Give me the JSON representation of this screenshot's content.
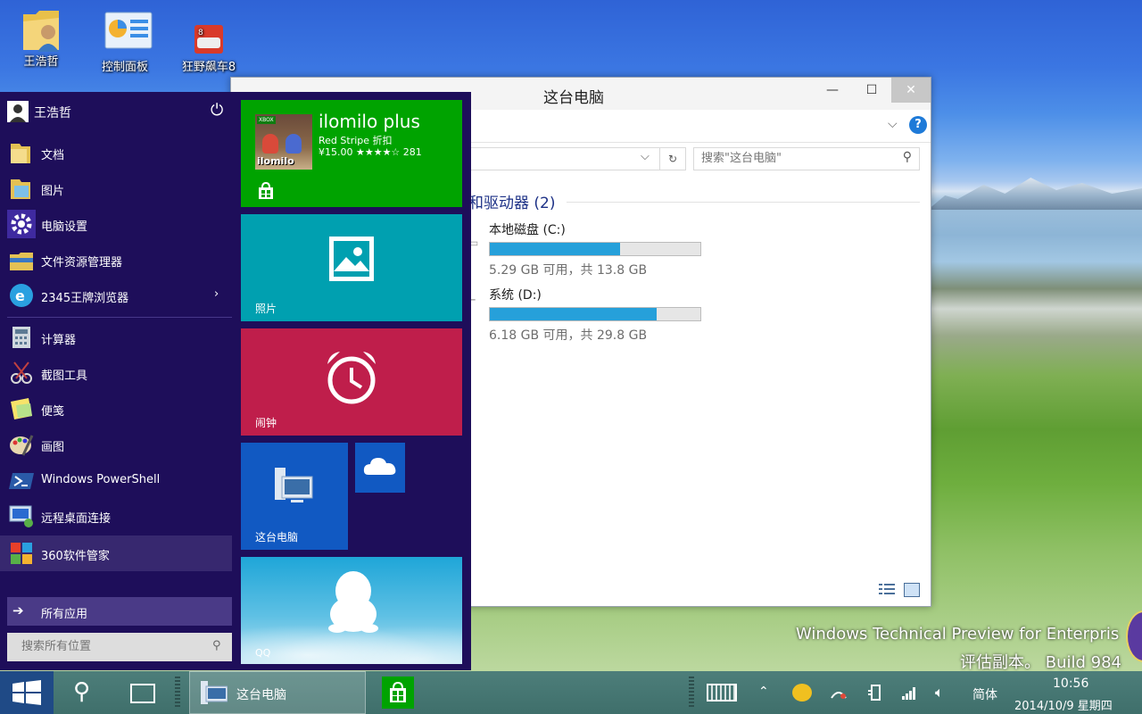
{
  "desktop": {
    "icons": [
      {
        "label": "王浩哲",
        "icon": "user-folder-icon"
      },
      {
        "label": "控制面板",
        "icon": "control-panel-icon"
      },
      {
        "label": "狂野飙车8",
        "icon": "asphalt-8-icon"
      }
    ],
    "watermark": {
      "line1": "Windows Technical Preview for Enterpris",
      "line2": "评估副本。 Build 984"
    }
  },
  "explorer": {
    "title": "这台电脑",
    "minimize": "—",
    "maximize": "☐",
    "close": "✕",
    "search_placeholder": "搜索\"这台电脑\"",
    "section_title": "和驱动器 (2)",
    "drives": [
      {
        "name": "本地磁盘 (C:)",
        "size_text": "5.29 GB 可用，共 13.8 GB",
        "used_fraction": 0.617
      },
      {
        "name": "系统 (D:)",
        "size_text": "6.18 GB 可用，共 29.8 GB",
        "used_fraction": 0.793
      }
    ]
  },
  "start_menu": {
    "user_name": "王浩哲",
    "items_top": [
      {
        "label": "文档",
        "icon": "documents-folder-icon"
      },
      {
        "label": "图片",
        "icon": "pictures-folder-icon"
      },
      {
        "label": "电脑设置",
        "icon": "gear-icon"
      },
      {
        "label": "文件资源管理器",
        "icon": "file-explorer-icon"
      },
      {
        "label": "2345王牌浏览器",
        "icon": "browser-icon"
      }
    ],
    "items_bottom": [
      {
        "label": "计算器",
        "icon": "calculator-icon"
      },
      {
        "label": "截图工具",
        "icon": "snipping-tool-icon"
      },
      {
        "label": "便笺",
        "icon": "sticky-notes-icon"
      },
      {
        "label": "画图",
        "icon": "paint-icon"
      },
      {
        "label": "Windows PowerShell",
        "icon": "powershell-icon"
      },
      {
        "label": "远程桌面连接",
        "icon": "remote-desktop-icon"
      },
      {
        "label": "360软件管家",
        "icon": "360-software-icon"
      }
    ],
    "all_apps": "所有应用",
    "search_placeholder": "搜索所有位置",
    "tiles": {
      "store": {
        "badge": "XBOX",
        "title": "ilomilo plus",
        "subtitle": "Red Stripe 折扣",
        "price": "¥15.00 ★★★★☆ 281",
        "game_art_text": "ilomilo"
      },
      "photos": {
        "label": "照片"
      },
      "alarm": {
        "label": "闹钟"
      },
      "this_pc": {
        "label": "这台电脑"
      },
      "qq": {
        "label": "QQ"
      }
    },
    "colors": {
      "bg": "#1e0e5a",
      "store_tile": "#00a300",
      "photos_tile": "#00a0b0",
      "alarm_tile": "#bf1e4b",
      "this_pc_tile": "#1159c2",
      "onedrive_tile": "#1159c2"
    }
  },
  "taskbar": {
    "explorer_label": "这台电脑",
    "ime": "简体",
    "time": "10:56",
    "date": "2014/10/9 星期四"
  }
}
